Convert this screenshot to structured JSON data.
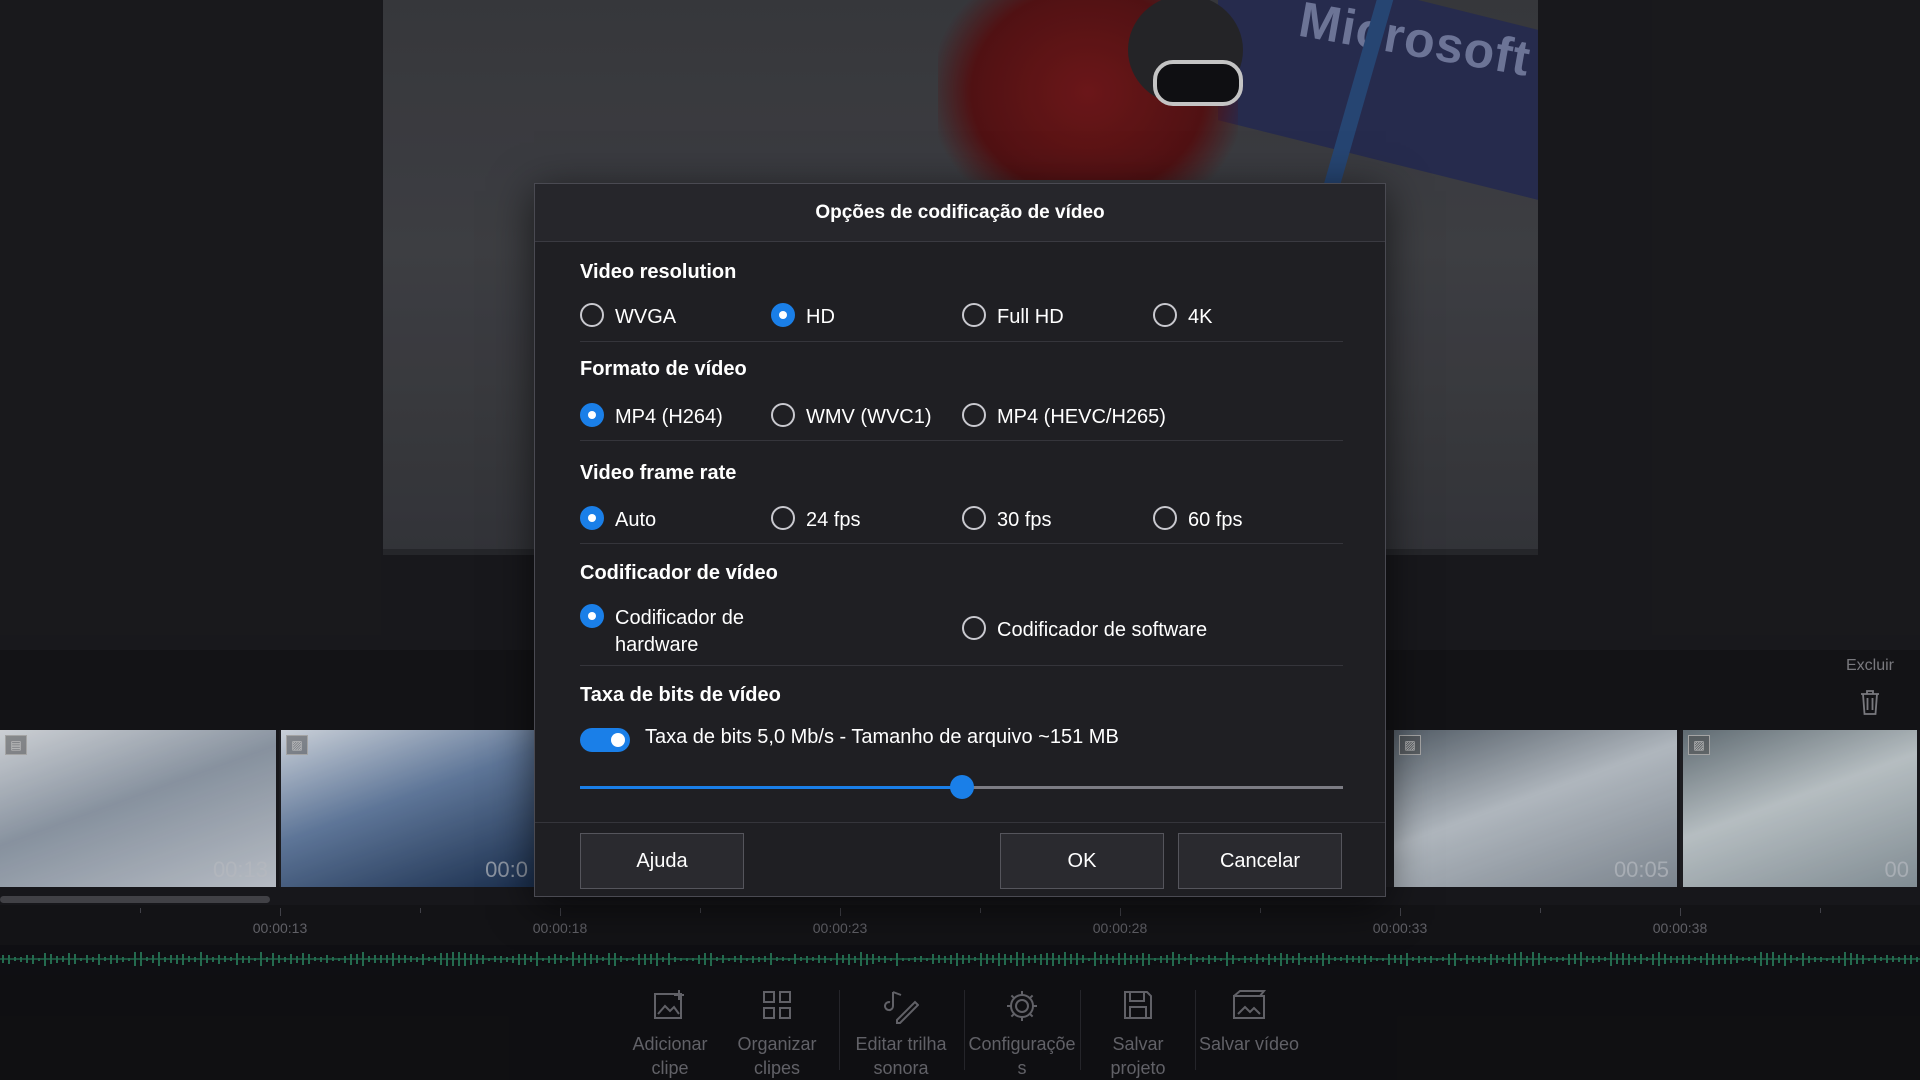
{
  "preview": {
    "flag_text": "Microsoft"
  },
  "timeline": {
    "delete_label": "Excluir",
    "clips": [
      {
        "time": "00:13",
        "colors": [
          "#cfd5de",
          "#9aa6b5",
          "#e8ecf1"
        ]
      },
      {
        "time": "00:0",
        "colors": [
          "#1e3558",
          "#6b86ad",
          "#e6edf6"
        ]
      },
      {
        "time": "",
        "colors": [
          "#7a8797",
          "#b4bfcb",
          "#dfe5ec"
        ]
      },
      {
        "time": "00:05",
        "colors": [
          "#8d97a2",
          "#c8d0d8",
          "#5f6a75"
        ]
      },
      {
        "time": "00",
        "colors": [
          "#93a0a8",
          "#cfd8dc",
          "#6d7a82"
        ]
      }
    ],
    "ticks": [
      "00:00:13",
      "00:00:18",
      "00:00:23",
      "00:00:28",
      "00:00:33",
      "00:00:38"
    ]
  },
  "toolbar": {
    "items": [
      {
        "id": "add-clip",
        "label1": "Adicionar",
        "label2": "clipe",
        "icon": "add-image-icon"
      },
      {
        "id": "organize-clips",
        "label1": "Organizar",
        "label2": "clipes",
        "icon": "grid-icon"
      },
      {
        "id": "edit-soundtrack",
        "label1": "Editar trilha",
        "label2": "sonora",
        "icon": "music-edit-icon"
      },
      {
        "id": "settings",
        "label1": "Configuraçõe",
        "label2": "s",
        "icon": "gear-icon"
      },
      {
        "id": "save-project",
        "label1": "Salvar",
        "label2": "projeto",
        "icon": "save-icon"
      },
      {
        "id": "save-video",
        "label1": "Salvar vídeo",
        "label2": "",
        "icon": "film-save-icon"
      }
    ]
  },
  "dialog": {
    "title": "Opções de codificação de vídeo",
    "resolution": {
      "title": "Video resolution",
      "options": [
        "WVGA",
        "HD",
        "Full HD",
        "4K"
      ],
      "selected": "HD"
    },
    "format": {
      "title": "Formato de vídeo",
      "options": [
        "MP4 (H264)",
        "WMV (WVC1)",
        "MP4 (HEVC/H265)"
      ],
      "selected": "MP4 (H264)"
    },
    "framerate": {
      "title": "Video frame rate",
      "options": [
        "Auto",
        "24 fps",
        "30 fps",
        "60 fps"
      ],
      "selected": "Auto"
    },
    "encoder": {
      "title": "Codificador de vídeo",
      "hardware_line1": "Codificador de",
      "hardware_line2": "hardware",
      "software": "Codificador de software",
      "selected": "hardware"
    },
    "bitrate": {
      "title": "Taxa de bits de vídeo",
      "toggle_on": true,
      "text": "Taxa de bits 5,0 Mb/s - Tamanho de arquivo ~151 MB",
      "slider_fraction": 0.5
    },
    "buttons": {
      "help": "Ajuda",
      "ok": "OK",
      "cancel": "Cancelar"
    }
  },
  "colors": {
    "accent": "#1a7fe8"
  }
}
